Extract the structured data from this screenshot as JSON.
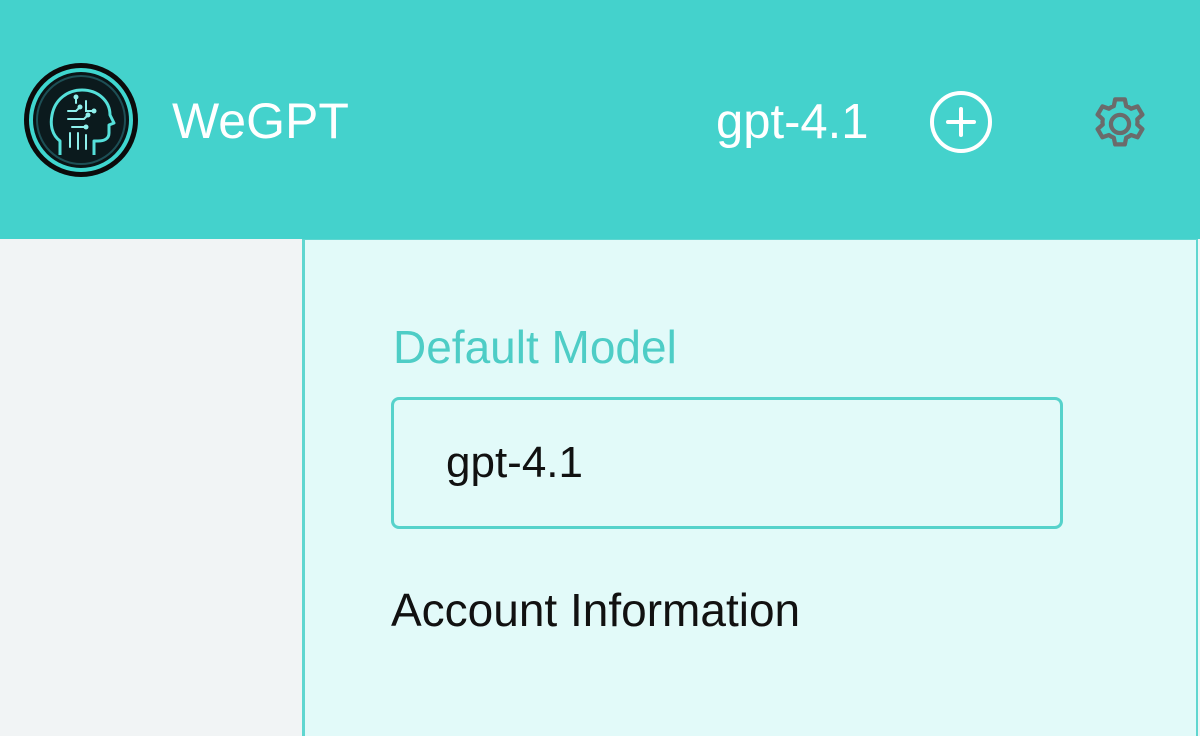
{
  "header": {
    "app_title": "WeGPT",
    "current_model": "gpt-4.1",
    "add_icon": "plus-circle-icon",
    "settings_icon": "gear-icon",
    "logo_icon": "brain-circuit-head-logo"
  },
  "settings": {
    "default_model_label": "Default Model",
    "default_model_value": "gpt-4.1",
    "account_section_title": "Account Information"
  },
  "colors": {
    "header_bg": "#44d2cc",
    "accent": "#4ecdc6",
    "panel_bg": "#e2faf9",
    "sidebar_bg": "#f1f4f5",
    "gear": "#6b6b6b"
  }
}
